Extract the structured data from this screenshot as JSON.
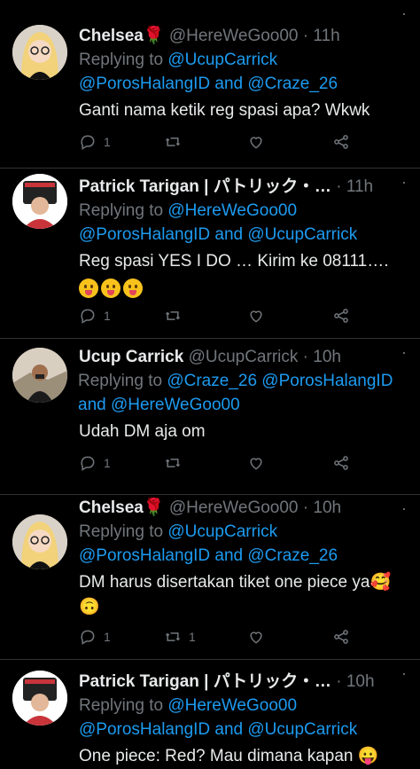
{
  "tweets": [
    {
      "name": "Chelsea",
      "name_emoji": "🌹",
      "handle": "@HereWeGoo00",
      "sep": "·",
      "time": "11h",
      "replying_prefix": "Replying to",
      "mentions_line1": [
        "@UcupCarrick"
      ],
      "mentions_line2": "@PorosHalangID and @Craze_26",
      "text_lines": [
        "Ganti nama ketik reg spasi apa? Wkwk"
      ],
      "reply_count": "1",
      "retweet_count": "",
      "like_count": ""
    },
    {
      "name": "Patrick Tarigan | パトリック・…",
      "handle": "",
      "sep": "·",
      "time": "11h",
      "replying_prefix": "Replying to",
      "mentions_line1": [
        "@HereWeGoo00"
      ],
      "mentions_line2": "@PorosHalangID and @UcupCarrick",
      "text_lines": [
        "Reg spasi YES I DO … Kirim ke 08111…."
      ],
      "emoji_row": "😛😛😛",
      "reply_count": "1",
      "retweet_count": "",
      "like_count": ""
    },
    {
      "name": "Ucup Carrick",
      "handle": "@UcupCarrick",
      "sep": "·",
      "time": "10h",
      "replying_prefix": "Replying to",
      "mentions_line1": [
        "@Craze_26",
        "@PorosHalangID"
      ],
      "mentions_line2": "and @HereWeGoo00",
      "text_lines": [
        "Udah DM aja om"
      ],
      "reply_count": "1",
      "retweet_count": "",
      "like_count": ""
    },
    {
      "name": "Chelsea",
      "name_emoji": "🌹",
      "handle": "@HereWeGoo00",
      "sep": "·",
      "time": "10h",
      "replying_prefix": "Replying to",
      "mentions_line1": [
        "@UcupCarrick"
      ],
      "mentions_line2": "@PorosHalangID and @Craze_26",
      "text_lines": [
        "DM harus disertakan tiket one piece ya🥰",
        "🙃"
      ],
      "reply_count": "1",
      "retweet_count": "1",
      "like_count": ""
    },
    {
      "name": "Patrick Tarigan | パトリック・…",
      "handle": "",
      "sep": "·",
      "time": "10h",
      "replying_prefix": "Replying to",
      "mentions_line1": [
        "@HereWeGoo00"
      ],
      "mentions_line2": "@PorosHalangID and @UcupCarrick",
      "text_lines": [
        "One piece: Red? Mau dimana kapan 😛"
      ]
    }
  ],
  "colors": {
    "background": "#000000",
    "text": "#e7e9ea",
    "muted": "#71767b",
    "link": "#1d9bf0",
    "divider": "#2f3336"
  },
  "icons": [
    "reply-icon",
    "retweet-icon",
    "like-icon",
    "share-icon",
    "more-icon"
  ]
}
